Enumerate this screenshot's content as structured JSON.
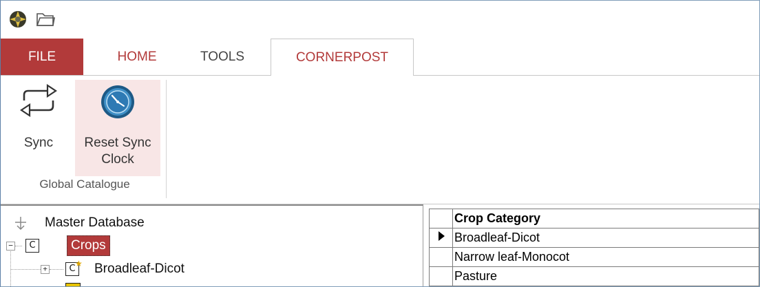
{
  "tabs": {
    "file": "FILE",
    "home": "HOME",
    "tools": "TOOLS",
    "cornerpost": "CORNERPOST"
  },
  "ribbon": {
    "sync_label": "Sync",
    "reset_line1": "Reset Sync",
    "reset_line2": "Clock",
    "group_label": "Global Catalogue"
  },
  "tree": {
    "root": "Master Database",
    "crops": "Crops",
    "child": "Broadleaf-Dicot"
  },
  "grid": {
    "header": "Crop Category",
    "rows": [
      "Broadleaf-Dicot",
      "Narrow leaf-Monocot",
      "Pasture"
    ]
  },
  "colors": {
    "accent": "#b23a3a",
    "selection_bg": "#f8e6e6"
  }
}
